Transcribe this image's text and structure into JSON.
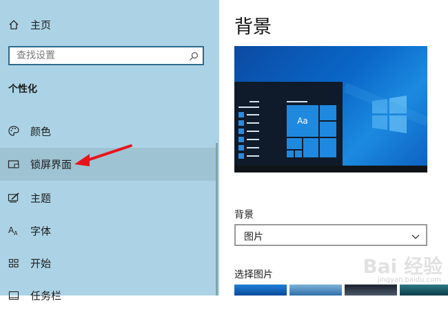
{
  "sidebar": {
    "home_label": "主页",
    "search_placeholder": "查找设置",
    "section_title": "个性化",
    "items": [
      {
        "label": "颜色",
        "icon": "palette-icon"
      },
      {
        "label": "锁屏界面",
        "icon": "lock-screen-icon"
      },
      {
        "label": "主题",
        "icon": "theme-icon"
      },
      {
        "label": "字体",
        "icon": "font-icon"
      },
      {
        "label": "开始",
        "icon": "start-icon"
      },
      {
        "label": "任务栏",
        "icon": "taskbar-icon"
      }
    ]
  },
  "main": {
    "title": "背景",
    "preview": {
      "tile_text": "Aa"
    },
    "background_dropdown": {
      "label": "背景",
      "value": "图片"
    },
    "choose_picture_label": "选择图片"
  },
  "watermark": {
    "text": "Bai 经验",
    "subtext": "jingyan.baidu.com"
  },
  "colors": {
    "sidebar_bg": "#acd3e5",
    "selected_bg": "#9ec3d2",
    "accent": "#0a67c8",
    "arrow": "#e8141b"
  }
}
